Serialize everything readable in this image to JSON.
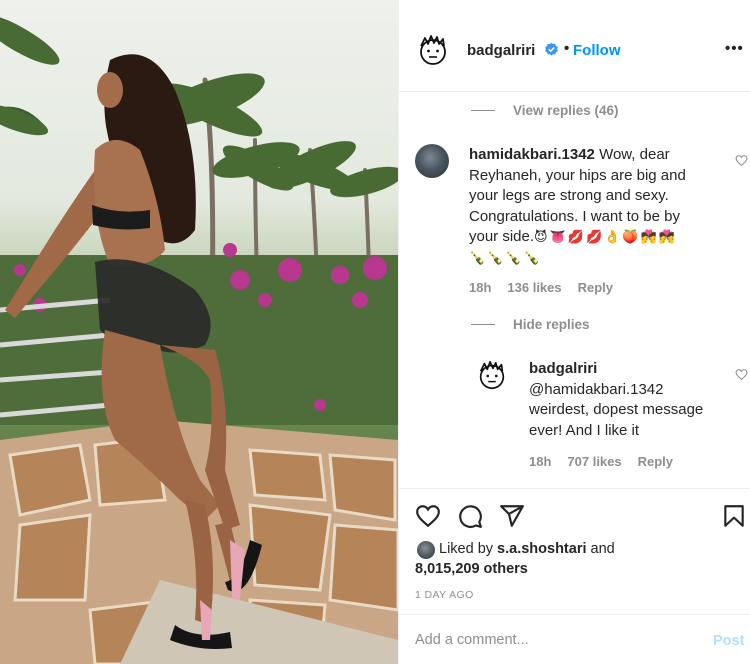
{
  "post": {
    "username": "badgalriri",
    "separator": "•",
    "follow_label": "Follow",
    "more_label": "•••",
    "verified_icon": "verified-badge-icon",
    "accent_color": "#0095f6"
  },
  "comments": {
    "view_replies_label": "View replies (46)",
    "hide_replies_label": "Hide replies",
    "items": [
      {
        "username": "hamidakbari.1342",
        "lines": [
          " Wow, dear",
          "Reyhaneh, your hips are big and",
          "your legs are strong and sexy.",
          "Congratulations. I want to be by",
          "your side."
        ],
        "emoji_line_1": "😈👅💋💋👌🍑💏💏",
        "emoji_line_2": "🍾🍾🍾🍾",
        "time": "18h",
        "likes": "136 likes",
        "reply_label": "Reply"
      },
      {
        "username": "badgalriri",
        "lines": [
          "@hamidakbari.1342",
          "weirdest, dopest message",
          "ever! And I like it"
        ],
        "time": "18h",
        "likes": "707 likes",
        "reply_label": "Reply"
      }
    ]
  },
  "actions": {
    "like_icon": "heart-icon",
    "comment_icon": "comment-icon",
    "share_icon": "share-icon",
    "save_icon": "bookmark-icon",
    "liked_by_prefix": "Liked by ",
    "liked_by_user": "s.a.shoshtari",
    "liked_by_and": " and",
    "liked_by_others": "8,015,209 others",
    "time_ago": "1 DAY AGO"
  },
  "add_comment": {
    "placeholder": "Add a comment...",
    "post_label": "Post"
  }
}
